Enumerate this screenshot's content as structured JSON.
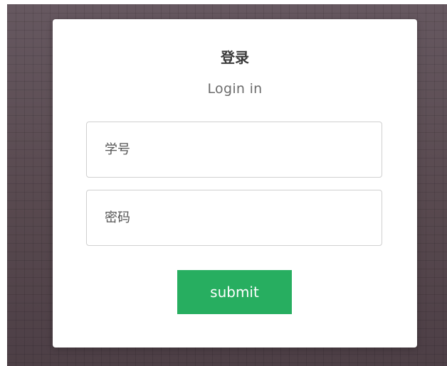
{
  "login_form": {
    "title": "登录",
    "subtitle": "Login in",
    "username": {
      "placeholder": "学号",
      "value": ""
    },
    "password": {
      "placeholder": "密码",
      "value": ""
    },
    "submit_label": "submit"
  },
  "colors": {
    "background": "#5e4e57",
    "card": "#ffffff",
    "accent": "#27ae60",
    "title_text": "#3a3a3a",
    "subtitle_text": "#6b6b6b"
  }
}
